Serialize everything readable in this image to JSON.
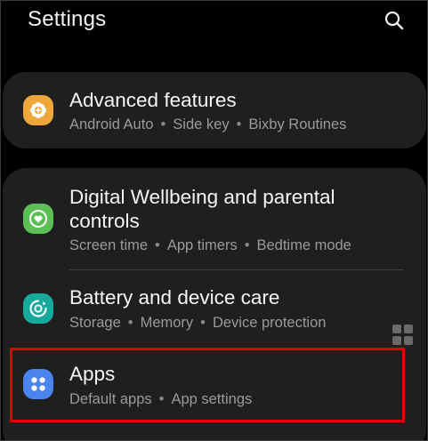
{
  "header": {
    "title": "Settings",
    "search_icon": "search-icon"
  },
  "colors": {
    "background": "#000000",
    "card": "#1f1f1f",
    "advanced_icon_bg": "#f0a73a",
    "wellbeing_icon_bg": "#5cbf55",
    "battery_icon_bg": "#17a99b",
    "apps_icon_bg": "#4a84f0",
    "highlight": "#e10000"
  },
  "items": [
    {
      "title": "Advanced features",
      "subtitle_parts": [
        "Android Auto",
        "Side key",
        "Bixby Routines"
      ],
      "icon": "gear-plus-icon"
    },
    {
      "title_line1": "Digital Wellbeing and parental",
      "title_line2": "controls",
      "subtitle_parts": [
        "Screen time",
        "App timers",
        "Bedtime mode"
      ],
      "icon": "wellbeing-heart-icon"
    },
    {
      "title": "Battery and device care",
      "subtitle_parts": [
        "Storage",
        "Memory",
        "Device protection"
      ],
      "icon": "device-care-icon"
    },
    {
      "title": "Apps",
      "subtitle_parts": [
        "Default apps",
        "App settings"
      ],
      "icon": "apps-grid-icon"
    }
  ],
  "separator": "•"
}
